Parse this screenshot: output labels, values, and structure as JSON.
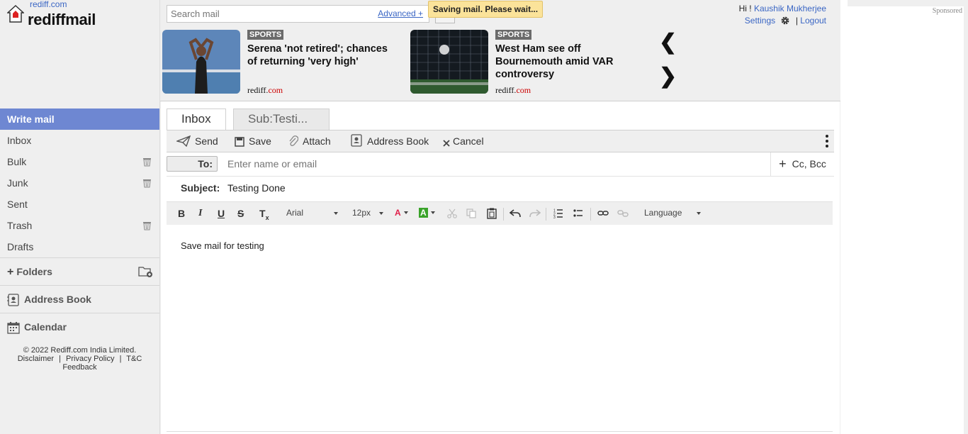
{
  "brand": {
    "small": "rediff.com",
    "big": "rediffmail"
  },
  "search": {
    "placeholder": "Search mail",
    "advanced": "Advanced +"
  },
  "toast": "Saving mail. Please wait...",
  "user": {
    "greeting": "Hi !",
    "name": "Kaushik Mukherjee",
    "settings": "Settings",
    "sep": "|",
    "logout": "Logout"
  },
  "news": [
    {
      "tag": "SPORTS",
      "headline": "Serena 'not retired'; chances of returning 'very high'",
      "source_a": "rediff.",
      "source_b": "com"
    },
    {
      "tag": "SPORTS",
      "headline": "West Ham see off Bournemouth amid VAR controversy",
      "source_a": "rediff.",
      "source_b": "com"
    }
  ],
  "ad": {
    "label": "Sponsored"
  },
  "sidebar": {
    "items": [
      {
        "label": "Write mail"
      },
      {
        "label": "Inbox"
      },
      {
        "label": "Bulk"
      },
      {
        "label": "Junk"
      },
      {
        "label": "Sent"
      },
      {
        "label": "Trash"
      },
      {
        "label": "Drafts"
      }
    ],
    "folders": "Folders",
    "address_book": "Address Book",
    "calendar": "Calendar"
  },
  "footer": {
    "copyright": "© 2022 Rediff.com India Limited.",
    "disclaimer": "Disclaimer",
    "privacy": "Privacy Policy",
    "tc": "T&C",
    "sep": "|",
    "feedback": "Feedback"
  },
  "tabs": [
    {
      "label": "Inbox"
    },
    {
      "label": "Sub:Testi..."
    }
  ],
  "toolbar": {
    "send": "Send",
    "save": "Save",
    "attach": "Attach",
    "address_book": "Address Book",
    "cancel": "Cancel"
  },
  "compose": {
    "to_label": "To:",
    "to_placeholder": "Enter name or email",
    "ccbcc": "Cc, Bcc",
    "subject_label": "Subject:",
    "subject_value": "Testing Done",
    "body": "Save mail for testing"
  },
  "editor": {
    "bold": "B",
    "italic": "I",
    "underline": "U",
    "strike": "S",
    "clear": "T",
    "clear_sub": "x",
    "font": "Arial",
    "size": "12px",
    "font_color": "A",
    "bg_color": "A",
    "language": "Language"
  },
  "colors": {
    "accent": "#6e87d2",
    "link": "#3a66c4",
    "toast": "#fbe39a",
    "bg_highlight": "#3aa32a",
    "font_color": "#e0204a"
  }
}
